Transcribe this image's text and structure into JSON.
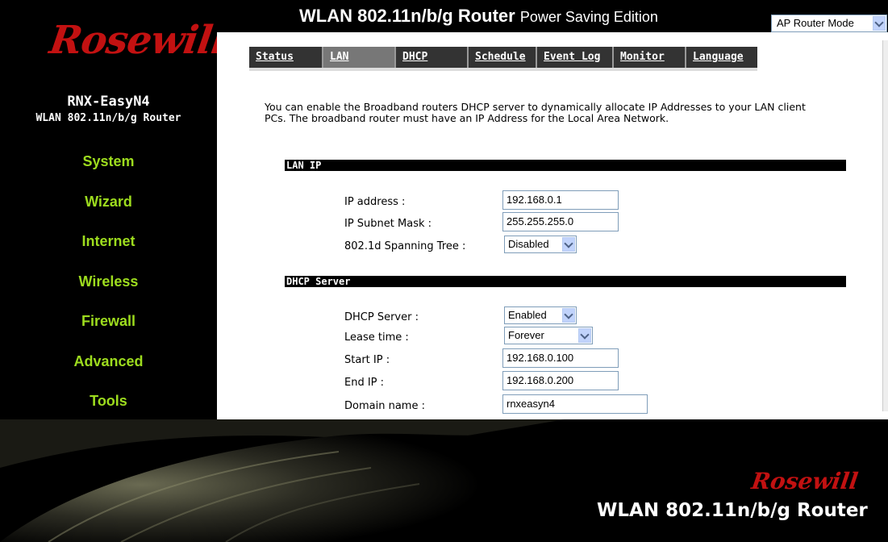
{
  "header": {
    "title_main": "WLAN 802.11n/b/g Router",
    "title_sub": "Power Saving Edition",
    "mode_select": "AP Router Mode"
  },
  "brand": {
    "logo_text": "Rosewill",
    "model_name": "RNX-EasyN4",
    "model_sub": "WLAN 802.11n/b/g Router",
    "logo_color": "#c21111"
  },
  "sidebar": {
    "items": [
      "System",
      "Wizard",
      "Internet",
      "Wireless",
      "Firewall",
      "Advanced",
      "Tools"
    ],
    "color": "#9ddc1e"
  },
  "tabs": [
    "Status",
    "LAN",
    "DHCP",
    "Schedule",
    "Event Log",
    "Monitor",
    "Language"
  ],
  "active_tab": "LAN",
  "intro": "You can enable the Broadband routers DHCP server to dynamically allocate IP Addresses to your LAN client PCs. The broadband router must have an IP Address for the Local Area Network.",
  "lan_ip": {
    "section_title": "LAN IP",
    "ip_label": "IP address :",
    "ip_value": "192.168.0.1",
    "mask_label": "IP Subnet Mask :",
    "mask_value": "255.255.255.0",
    "stp_label": "802.1d Spanning Tree :",
    "stp_value": "Disabled"
  },
  "dhcp": {
    "section_title": "DHCP Server",
    "server_label": "DHCP Server :",
    "server_value": "Enabled",
    "lease_label": "Lease time :",
    "lease_value": "Forever",
    "start_label": "Start IP :",
    "start_value": "192.168.0.100",
    "end_label": "End IP :",
    "end_value": "192.168.0.200",
    "domain_label": "Domain name :",
    "domain_value": "rnxeasyn4"
  },
  "footer": {
    "logo_text": "Rosewill",
    "text": "WLAN 802.11n/b/g Router"
  }
}
